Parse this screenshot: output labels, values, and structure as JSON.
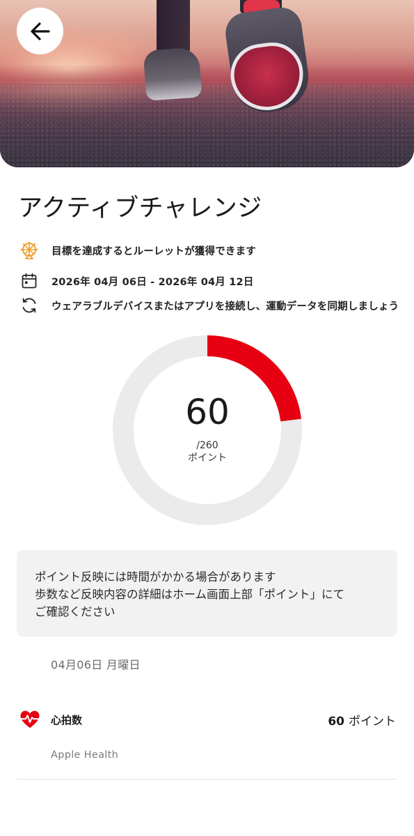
{
  "header": {
    "back_icon": "arrow-left-icon"
  },
  "title": "アクティブチャレンジ",
  "info": {
    "roulette": {
      "icon": "roulette-wheel-icon",
      "text": "目標を達成するとルーレットが獲得できます",
      "icon_color": "#f0a030"
    },
    "period": {
      "icon": "calendar-icon",
      "text": "2026年 04月 06日 - 2026年 04月 12日"
    },
    "sync": {
      "icon": "sync-icon",
      "text": "ウェアラブルデバイスまたはアプリを接続し、運動データを同期しましょう"
    }
  },
  "progress": {
    "value": "60",
    "total": "/260",
    "unit": "ポイント",
    "current": 60,
    "max": 260,
    "fill_color": "#e60012",
    "track_color": "#ebebeb"
  },
  "notice": {
    "lines": [
      "ポイント反映には時間がかかる場合があります",
      "歩数など反映内容の詳細はホーム画面上部「ポイント」にて",
      "ご確認ください"
    ]
  },
  "day": {
    "label": "04月06日 月曜日",
    "items": [
      {
        "icon": "heart-rate-icon",
        "icon_color": "#e60012",
        "label": "心拍数",
        "points": "60",
        "points_unit": "ポイント",
        "source": "Apple Health"
      }
    ]
  }
}
